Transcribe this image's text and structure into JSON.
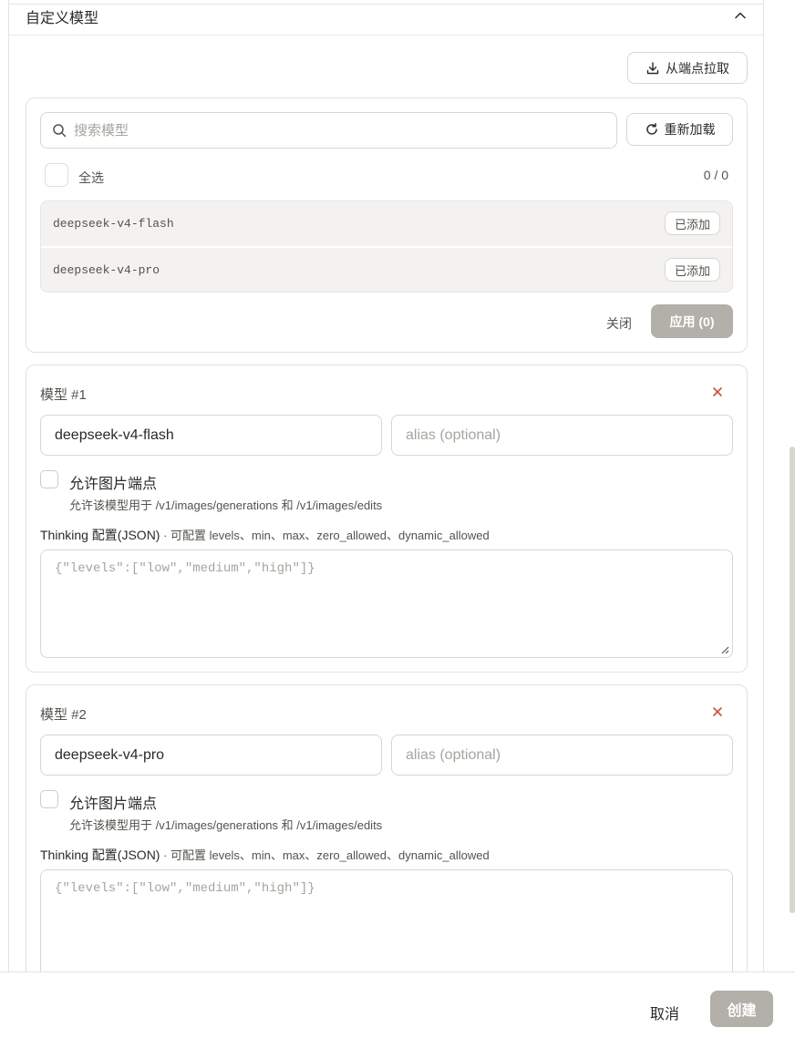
{
  "section": {
    "title": "自定义模型"
  },
  "fetch": {
    "fetch_button": "从端点拉取",
    "search_placeholder": "搜索模型",
    "reload_button": "重新加载",
    "select_all": "全选",
    "count": "0 / 0",
    "items": [
      {
        "name": "deepseek-v4-flash",
        "status": "已添加"
      },
      {
        "name": "deepseek-v4-pro",
        "status": "已添加"
      }
    ],
    "close_button": "关闭",
    "apply_button": "应用 (0)"
  },
  "models": [
    {
      "title": "模型 #1",
      "name": "deepseek-v4-flash",
      "alias_placeholder": "alias (optional)",
      "allow_images_label": "允许图片端点",
      "allow_images_desc": "允许该模型用于 /v1/images/generations 和 /v1/images/edits",
      "thinking_label": "Thinking 配置(JSON)",
      "thinking_hint": " · 可配置 levels、min、max、zero_allowed、dynamic_allowed",
      "thinking_placeholder": "{\"levels\":[\"low\",\"medium\",\"high\"]}"
    },
    {
      "title": "模型 #2",
      "name": "deepseek-v4-pro",
      "alias_placeholder": "alias (optional)",
      "allow_images_label": "允许图片端点",
      "allow_images_desc": "允许该模型用于 /v1/images/generations 和 /v1/images/edits",
      "thinking_label": "Thinking 配置(JSON)",
      "thinking_hint": " · 可配置 levels、min、max、zero_allowed、dynamic_allowed",
      "thinking_placeholder": "{\"levels\":[\"low\",\"medium\",\"high\"]}"
    }
  ],
  "footer": {
    "cancel_button": "取消",
    "create_button": "创建"
  },
  "colors": {
    "accent_disabled": "#b3afa9",
    "remove": "#c0553a",
    "text": "#2b2a28"
  }
}
